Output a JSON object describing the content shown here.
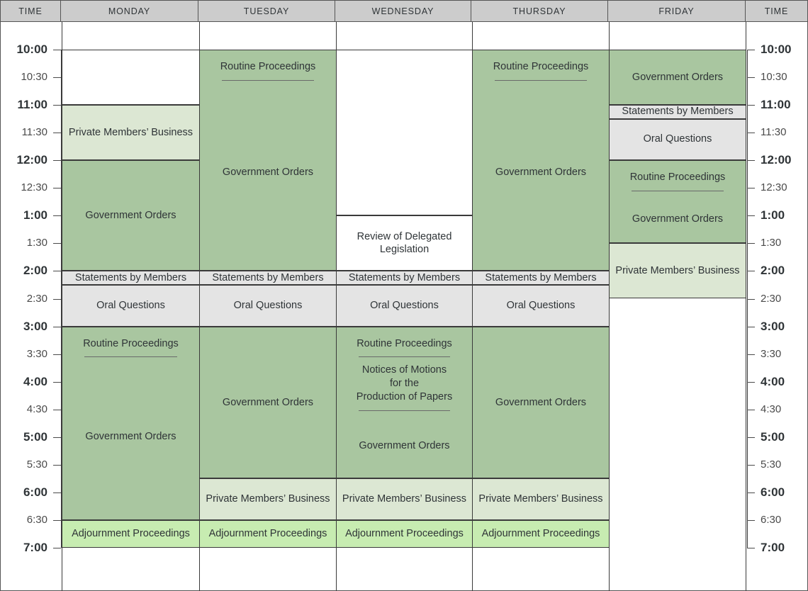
{
  "header": {
    "columns": [
      {
        "label": "TIME",
        "name": "time-left"
      },
      {
        "label": "MONDAY",
        "name": "monday"
      },
      {
        "label": "TUESDAY",
        "name": "tuesday"
      },
      {
        "label": "WEDNESDAY",
        "name": "wednesday"
      },
      {
        "label": "THURSDAY",
        "name": "thursday"
      },
      {
        "label": "FRIDAY",
        "name": "friday"
      },
      {
        "label": "TIME",
        "name": "time-right"
      }
    ]
  },
  "time_axis": {
    "start": "10:00",
    "end": "7:00",
    "ticks": [
      {
        "label": "10:00",
        "hour": 10.0,
        "major": true
      },
      {
        "label": "10:30",
        "hour": 10.5,
        "major": false
      },
      {
        "label": "11:00",
        "hour": 11.0,
        "major": true
      },
      {
        "label": "11:30",
        "hour": 11.5,
        "major": false
      },
      {
        "label": "12:00",
        "hour": 12.0,
        "major": true
      },
      {
        "label": "12:30",
        "hour": 12.5,
        "major": false
      },
      {
        "label": "1:00",
        "hour": 13.0,
        "major": true
      },
      {
        "label": "1:30",
        "hour": 13.5,
        "major": false
      },
      {
        "label": "2:00",
        "hour": 14.0,
        "major": true
      },
      {
        "label": "2:30",
        "hour": 14.5,
        "major": false
      },
      {
        "label": "3:00",
        "hour": 15.0,
        "major": true
      },
      {
        "label": "3:30",
        "hour": 15.5,
        "major": false
      },
      {
        "label": "4:00",
        "hour": 16.0,
        "major": true
      },
      {
        "label": "4:30",
        "hour": 16.5,
        "major": false
      },
      {
        "label": "5:00",
        "hour": 17.0,
        "major": true
      },
      {
        "label": "5:30",
        "hour": 17.5,
        "major": false
      },
      {
        "label": "6:00",
        "hour": 18.0,
        "major": true
      },
      {
        "label": "6:30",
        "hour": 18.5,
        "major": false
      },
      {
        "label": "7:00",
        "hour": 19.0,
        "major": true
      }
    ]
  },
  "colors": {
    "government_orders": "#a9c6a0",
    "private_members": "#dce7d3",
    "statements": "#e4e4e4",
    "oral_questions": "#e4e4e4",
    "adjournment": "#c7ecb1",
    "header_bg": "#cccccc",
    "border": "#3a3a3a",
    "text": "#2f3437"
  },
  "days": [
    {
      "name": "monday",
      "blocks": [
        {
          "name": "empty",
          "start": 10.0,
          "end": 11.0,
          "style": "c-empty",
          "labels": []
        },
        {
          "name": "private-members",
          "start": 11.0,
          "end": 12.0,
          "style": "c-private",
          "labels": [
            "Private Members’ Business"
          ]
        },
        {
          "name": "government-orders",
          "start": 12.0,
          "end": 14.0,
          "style": "c-government",
          "labels": [
            "Government Orders"
          ]
        },
        {
          "name": "statements",
          "start": 14.0,
          "end": 14.25,
          "style": "c-statements",
          "labels": [
            "Statements by Members"
          ]
        },
        {
          "name": "oral-questions",
          "start": 14.25,
          "end": 15.0,
          "style": "c-oral",
          "labels": [
            "Oral Questions"
          ]
        },
        {
          "name": "routine-and-government",
          "start": 15.0,
          "end": 18.5,
          "style": "c-government",
          "stacked": true,
          "labels": [
            "Routine Proceedings"
          ],
          "rule_after_first": true,
          "trailing_label": "Government Orders"
        },
        {
          "name": "adjournment",
          "start": 18.5,
          "end": 19.0,
          "style": "c-adjourn",
          "labels": [
            "Adjournment Proceedings"
          ]
        }
      ]
    },
    {
      "name": "tuesday",
      "blocks": [
        {
          "name": "routine-and-government",
          "start": 10.0,
          "end": 14.0,
          "style": "c-government",
          "stacked": true,
          "labels": [
            "Routine Proceedings"
          ],
          "rule_after_first": true,
          "trailing_label": "Government Orders"
        },
        {
          "name": "statements",
          "start": 14.0,
          "end": 14.25,
          "style": "c-statements",
          "labels": [
            "Statements by Members"
          ]
        },
        {
          "name": "oral-questions",
          "start": 14.25,
          "end": 15.0,
          "style": "c-oral",
          "labels": [
            "Oral Questions"
          ]
        },
        {
          "name": "government-orders",
          "start": 15.0,
          "end": 17.75,
          "style": "c-government",
          "labels": [
            "Government Orders"
          ]
        },
        {
          "name": "private-members",
          "start": 17.75,
          "end": 18.5,
          "style": "c-private",
          "labels": [
            "Private Members’ Business"
          ]
        },
        {
          "name": "adjournment",
          "start": 18.5,
          "end": 19.0,
          "style": "c-adjourn",
          "labels": [
            "Adjournment Proceedings"
          ]
        }
      ]
    },
    {
      "name": "wednesday",
      "blocks": [
        {
          "name": "empty",
          "start": 10.0,
          "end": 13.0,
          "style": "c-empty",
          "labels": []
        },
        {
          "name": "review-delegated-legislation",
          "start": 13.0,
          "end": 14.0,
          "style": "c-review",
          "labels": [
            "Review of Delegated\nLegislation"
          ]
        },
        {
          "name": "statements",
          "start": 14.0,
          "end": 14.25,
          "style": "c-statements",
          "labels": [
            "Statements by Members"
          ]
        },
        {
          "name": "oral-questions",
          "start": 14.25,
          "end": 15.0,
          "style": "c-oral",
          "labels": [
            "Oral Questions"
          ]
        },
        {
          "name": "routine-notices-government",
          "start": 15.0,
          "end": 17.75,
          "style": "c-government",
          "stacked": true,
          "labels": [
            "Routine Proceedings",
            "Notices of Motions\nfor the\nProduction of Papers"
          ],
          "rule_after_first": true,
          "rule_after_second": true,
          "trailing_label": "Government Orders"
        },
        {
          "name": "private-members",
          "start": 17.75,
          "end": 18.5,
          "style": "c-private",
          "labels": [
            "Private Members’ Business"
          ]
        },
        {
          "name": "adjournment",
          "start": 18.5,
          "end": 19.0,
          "style": "c-adjourn",
          "labels": [
            "Adjournment Proceedings"
          ]
        }
      ]
    },
    {
      "name": "thursday",
      "blocks": [
        {
          "name": "routine-and-government",
          "start": 10.0,
          "end": 14.0,
          "style": "c-government",
          "stacked": true,
          "labels": [
            "Routine Proceedings"
          ],
          "rule_after_first": true,
          "trailing_label": "Government Orders"
        },
        {
          "name": "statements",
          "start": 14.0,
          "end": 14.25,
          "style": "c-statements",
          "labels": [
            "Statements by Members"
          ]
        },
        {
          "name": "oral-questions",
          "start": 14.25,
          "end": 15.0,
          "style": "c-oral",
          "labels": [
            "Oral Questions"
          ]
        },
        {
          "name": "government-orders",
          "start": 15.0,
          "end": 17.75,
          "style": "c-government",
          "labels": [
            "Government Orders"
          ]
        },
        {
          "name": "private-members",
          "start": 17.75,
          "end": 18.5,
          "style": "c-private",
          "labels": [
            "Private Members’ Business"
          ]
        },
        {
          "name": "adjournment",
          "start": 18.5,
          "end": 19.0,
          "style": "c-adjourn",
          "labels": [
            "Adjournment Proceedings"
          ]
        }
      ]
    },
    {
      "name": "friday",
      "blocks": [
        {
          "name": "government-orders-morning",
          "start": 10.0,
          "end": 11.0,
          "style": "c-government",
          "labels": [
            "Government Orders"
          ]
        },
        {
          "name": "statements",
          "start": 11.0,
          "end": 11.25,
          "style": "c-statements",
          "labels": [
            "Statements by Members"
          ]
        },
        {
          "name": "oral-questions",
          "start": 11.25,
          "end": 12.0,
          "style": "c-oral",
          "labels": [
            "Oral Questions"
          ]
        },
        {
          "name": "routine-and-government",
          "start": 12.0,
          "end": 13.5,
          "style": "c-government",
          "stacked": true,
          "labels": [
            "Routine Proceedings"
          ],
          "rule_after_first": true,
          "trailing_label": "Government Orders"
        },
        {
          "name": "private-members",
          "start": 13.5,
          "end": 14.5,
          "style": "c-private",
          "labels": [
            "Private Members’ Business"
          ]
        }
      ]
    }
  ]
}
